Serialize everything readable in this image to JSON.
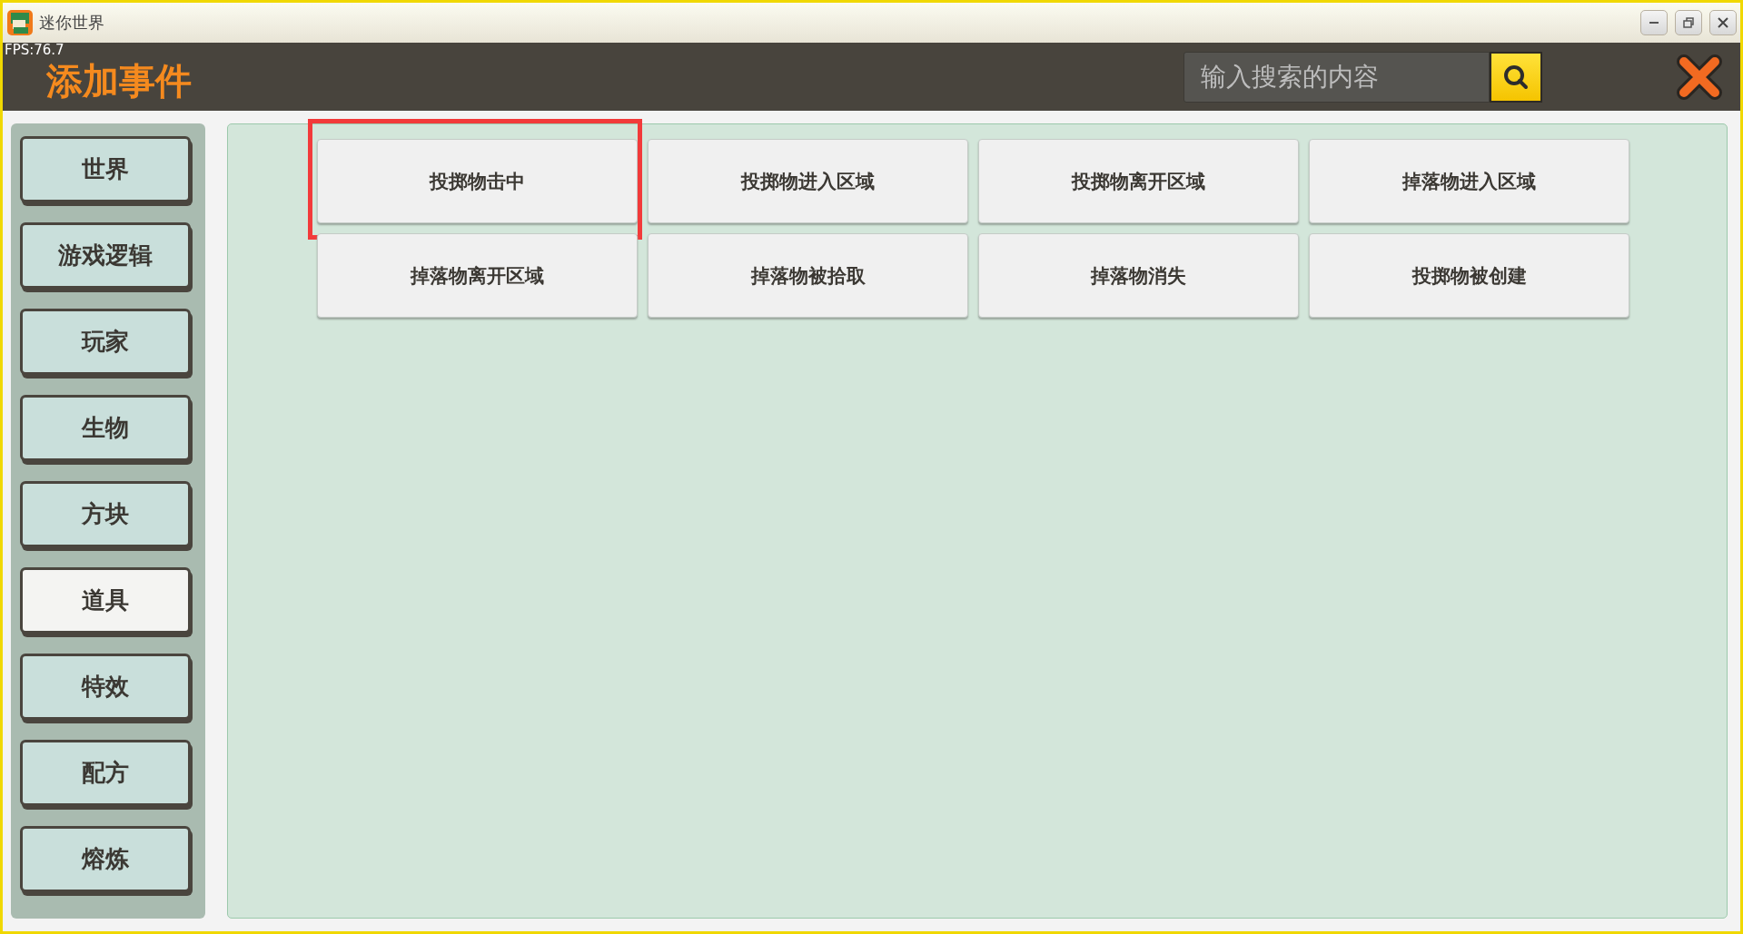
{
  "window": {
    "title": "迷你世界"
  },
  "fps": "FPS:76.7",
  "header": {
    "title": "添加事件",
    "search": {
      "placeholder": "输入搜索的内容"
    }
  },
  "sidebar": {
    "items": [
      {
        "label": "世界",
        "selected": false
      },
      {
        "label": "游戏逻辑",
        "selected": false
      },
      {
        "label": "玩家",
        "selected": false
      },
      {
        "label": "生物",
        "selected": false
      },
      {
        "label": "方块",
        "selected": false
      },
      {
        "label": "道具",
        "selected": true
      },
      {
        "label": "特效",
        "selected": false
      },
      {
        "label": "配方",
        "selected": false
      },
      {
        "label": "熔炼",
        "selected": false
      }
    ]
  },
  "events": [
    {
      "label": "投掷物击中",
      "highlighted": true
    },
    {
      "label": "投掷物进入区域",
      "highlighted": false
    },
    {
      "label": "投掷物离开区域",
      "highlighted": false
    },
    {
      "label": "掉落物进入区域",
      "highlighted": false
    },
    {
      "label": "掉落物离开区域",
      "highlighted": false
    },
    {
      "label": "掉落物被拾取",
      "highlighted": false
    },
    {
      "label": "掉落物消失",
      "highlighted": false
    },
    {
      "label": "投掷物被创建",
      "highlighted": false
    }
  ]
}
